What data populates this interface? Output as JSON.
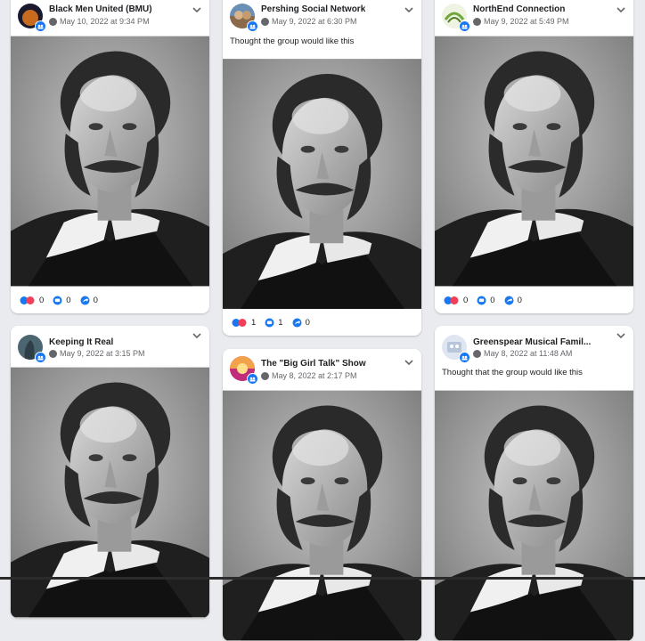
{
  "posts": [
    {
      "group_name": "Black Men United (BMU)",
      "timestamp": "May 10, 2022 at 9:34 PM",
      "text": "",
      "reactions": "0",
      "comments": "0",
      "shares": "0",
      "avatar_color": "#1a1a2e"
    },
    {
      "group_name": "Pershing Social Network",
      "timestamp": "May 9, 2022 at 6:30 PM",
      "text": "Thought the group would like this",
      "reactions": "1",
      "comments": "1",
      "shares": "0",
      "avatar_color": "#6a8fb5"
    },
    {
      "group_name": "NorthEnd Connection",
      "timestamp": "May 9, 2022 at 5:49 PM",
      "text": "",
      "reactions": "0",
      "comments": "0",
      "shares": "0",
      "avatar_color": "#6fa83a"
    },
    {
      "group_name": "Keeping It Real",
      "timestamp": "May 9, 2022 at 3:15 PM",
      "text": "",
      "avatar_color": "#4b6670"
    },
    {
      "group_name": "The \"Big Girl Talk\" Show",
      "timestamp": "May 8, 2022 at 2:17 PM",
      "text": "",
      "avatar_color": "#d83c86"
    },
    {
      "group_name": "Greenspear Musical Famil...",
      "timestamp": "May 8, 2022 at 11:48 AM",
      "text": "Thought that the group would like this",
      "avatar_color": "#b8c6dc"
    }
  ],
  "icons": {
    "globe": "globe-icon",
    "group": "group-badge-icon",
    "options": "chevron-down-icon",
    "reactions": "reaction-icons",
    "comments": "comment-icon",
    "shares": "share-icon"
  },
  "colors": {
    "accent": "#1877f2",
    "background": "#e9ebee"
  }
}
